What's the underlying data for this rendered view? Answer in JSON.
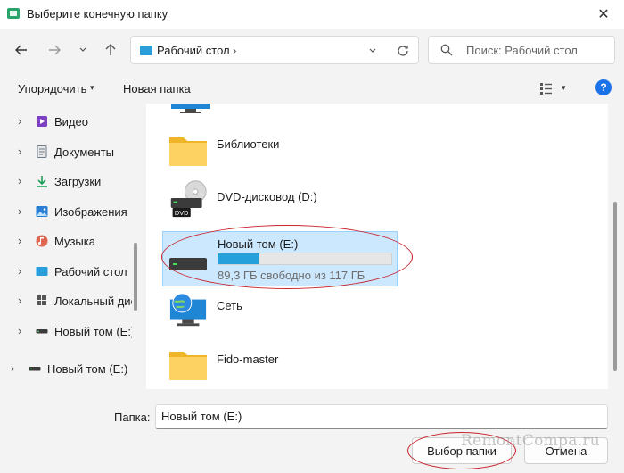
{
  "window": {
    "title": "Выберите конечную папку",
    "close_glyph": "✕"
  },
  "nav": {
    "back_glyph": "←",
    "forward_glyph": "→",
    "history_glyph": "⌄",
    "up_glyph": "↑",
    "address": {
      "path": "Рабочий стол",
      "separator": "›",
      "dropdown_glyph": "⌄",
      "refresh_glyph": "⟳"
    },
    "search": {
      "placeholder": "Поиск: Рабочий стол"
    }
  },
  "toolbar": {
    "sort_label": "Упорядочить",
    "sort_caret": "▾",
    "new_folder_label": "Новая папка",
    "view_caret": "▾",
    "help_glyph": "?"
  },
  "sidebar": {
    "items": [
      {
        "label": "Видео",
        "chevron": "›"
      },
      {
        "label": "Документы",
        "chevron": "›"
      },
      {
        "label": "Загрузки",
        "chevron": "›"
      },
      {
        "label": "Изображения",
        "chevron": "›"
      },
      {
        "label": "Музыка",
        "chevron": "›"
      },
      {
        "label": "Рабочий стол",
        "chevron": "›"
      },
      {
        "label": "Локальный дис",
        "chevron": "›"
      },
      {
        "label": "Новый том (E:)",
        "chevron": "›"
      },
      {
        "label": "Новый том (E:)",
        "chevron": "›"
      }
    ]
  },
  "main": {
    "items": [
      {
        "label": "Библиотеки",
        "icon": "libraries-folder-icon"
      },
      {
        "label": "DVD-дисковод (D:)",
        "icon": "dvd-drive-icon",
        "dvd_badge": "DVD"
      },
      {
        "label": "Новый том (E:)",
        "icon": "hard-drive-icon",
        "usage_text": "89,3 ГБ свободно из 117 ГБ",
        "used_fraction": 0.237
      },
      {
        "label": "Сеть",
        "icon": "network-icon"
      },
      {
        "label": "Fido-master",
        "icon": "folder-icon"
      }
    ]
  },
  "bottom": {
    "folder_label": "Папка:",
    "folder_value": "Новый том (E:)",
    "select_button": "Выбор папки",
    "cancel_button": "Отмена",
    "watermark": "RemontCompa.ru"
  },
  "colors": {
    "accent": "#26a0da",
    "selection_bg": "#cce8ff",
    "annotation": "#c8232c"
  }
}
